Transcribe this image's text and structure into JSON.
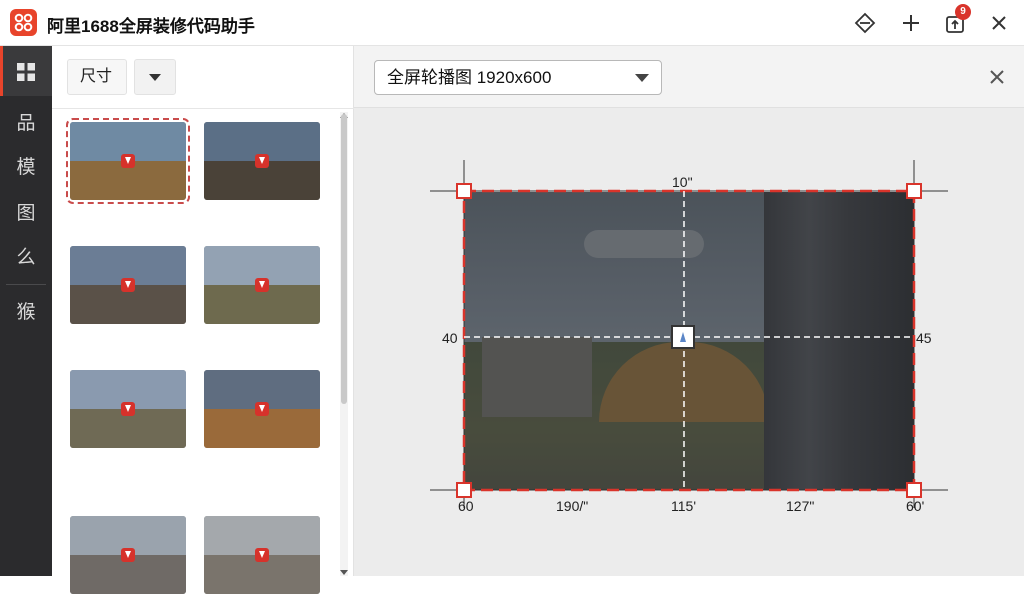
{
  "app": {
    "title": "阿里1688全屏装修代码助手",
    "brand_color": "#e8442b",
    "notification_count": "9",
    "toolbar_icons": [
      "diamond-share-icon",
      "plus-icon",
      "export-icon",
      "close-icon"
    ]
  },
  "rail": {
    "items": [
      {
        "icon": "grid-icon",
        "label": ""
      },
      {
        "label": "品"
      },
      {
        "label": "模"
      },
      {
        "label": "图"
      },
      {
        "label": "么"
      },
      {
        "label": "猴"
      }
    ]
  },
  "left_panel": {
    "size_filter_label": "尺寸",
    "thumbnails": [
      {
        "selected": true,
        "sky": "#6f8aa3",
        "ground": "#8b6a3e"
      },
      {
        "selected": false,
        "sky": "#5b6f86",
        "ground": "#4a4238"
      },
      {
        "selected": false,
        "sky": "#6b7d95",
        "ground": "#5a5148"
      },
      {
        "selected": false,
        "sky": "#93a2b3",
        "ground": "#6e6a4e"
      },
      {
        "selected": false,
        "sky": "#8a9aaf",
        "ground": "#6f6a55"
      },
      {
        "selected": false,
        "sky": "#5f6d80",
        "ground": "#9a6a3a"
      },
      {
        "selected": false,
        "sky": "#9aa3ad",
        "ground": "#6f6a66"
      },
      {
        "selected": false,
        "sky": "#a4a8ac",
        "ground": "#7a746c"
      }
    ]
  },
  "editor": {
    "template_select": "全屏轮播图 1920x600",
    "dims": {
      "top": "10\"",
      "left": "40",
      "right": "45",
      "bottom_left": "60",
      "bottom_1": "190/\"",
      "bottom_2": "115'",
      "bottom_3": "127\"",
      "bottom_right": "60'"
    },
    "guide_color": "#d9342b"
  }
}
